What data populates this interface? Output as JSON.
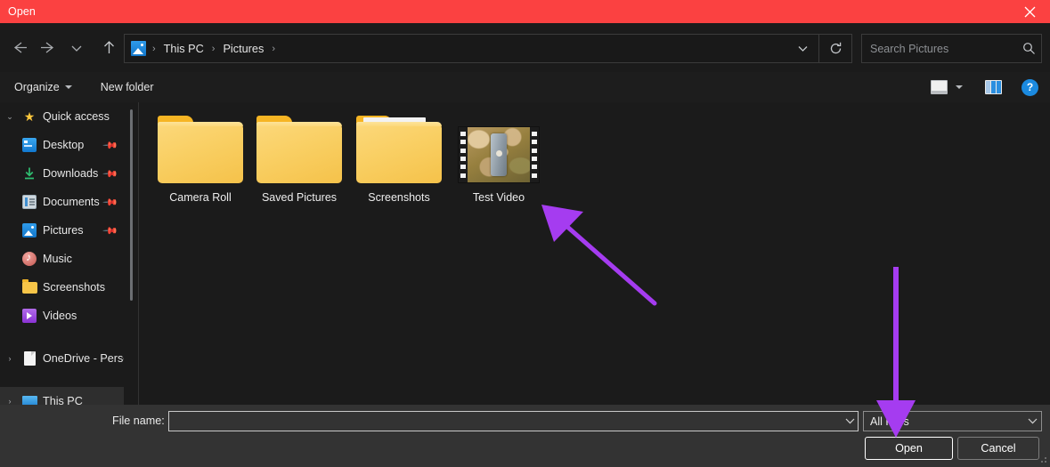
{
  "window": {
    "title": "Open",
    "close_label": "×",
    "titlebar_color": "#fb4141"
  },
  "nav": {
    "back_icon": "back-arrow-icon",
    "forward_icon": "forward-arrow-icon",
    "recent_icon": "chevron-down-icon",
    "up_icon": "up-arrow-icon",
    "dropdown_icon": "chevron-down-icon",
    "refresh_icon": "refresh-icon"
  },
  "address": {
    "location_icon": "pictures-folder-icon",
    "crumbs": [
      "This PC",
      "Pictures"
    ],
    "separator": "›"
  },
  "search": {
    "placeholder": "Search Pictures",
    "icon": "search-icon"
  },
  "commandbar": {
    "organize_label": "Organize",
    "new_folder_label": "New folder",
    "view_icon": "view-layout-icon",
    "pane_icon": "preview-pane-icon",
    "help_label": "?"
  },
  "sidebar": {
    "groups": [
      {
        "name": "Quick access",
        "icon": "star-icon",
        "expanded": true,
        "chevron": "⌄",
        "items": [
          {
            "label": "Desktop",
            "icon": "desktop-icon",
            "pinned": true
          },
          {
            "label": "Downloads",
            "icon": "downloads-icon",
            "pinned": true
          },
          {
            "label": "Documents",
            "icon": "documents-icon",
            "pinned": true
          },
          {
            "label": "Pictures",
            "icon": "pictures-icon",
            "pinned": true
          },
          {
            "label": "Music",
            "icon": "music-icon",
            "pinned": false
          },
          {
            "label": "Screenshots",
            "icon": "folder-icon",
            "pinned": false
          },
          {
            "label": "Videos",
            "icon": "videos-icon",
            "pinned": false
          }
        ]
      },
      {
        "name": "OneDrive - Perso",
        "icon": "onedrive-icon",
        "expanded": false,
        "chevron": "›",
        "items": []
      },
      {
        "name": "This PC",
        "icon": "this-pc-icon",
        "expanded": false,
        "chevron": "›",
        "items": [],
        "selected": true
      }
    ]
  },
  "files": [
    {
      "name": "Camera Roll",
      "type": "folder"
    },
    {
      "name": "Saved Pictures",
      "type": "folder"
    },
    {
      "name": "Screenshots",
      "type": "folder"
    },
    {
      "name": "Test Video",
      "type": "video-thumbnail"
    }
  ],
  "footer": {
    "filename_label": "File name:",
    "filename_value": "",
    "filename_placeholder": "",
    "filetype_value": "All Files",
    "open_label": "Open",
    "cancel_label": "Cancel"
  },
  "annotations": {
    "color": "#a53cf0",
    "arrows": [
      {
        "name": "arrow-pointing-to-test-video",
        "direction": "up-left"
      },
      {
        "name": "arrow-pointing-to-open-button",
        "direction": "down"
      }
    ]
  }
}
